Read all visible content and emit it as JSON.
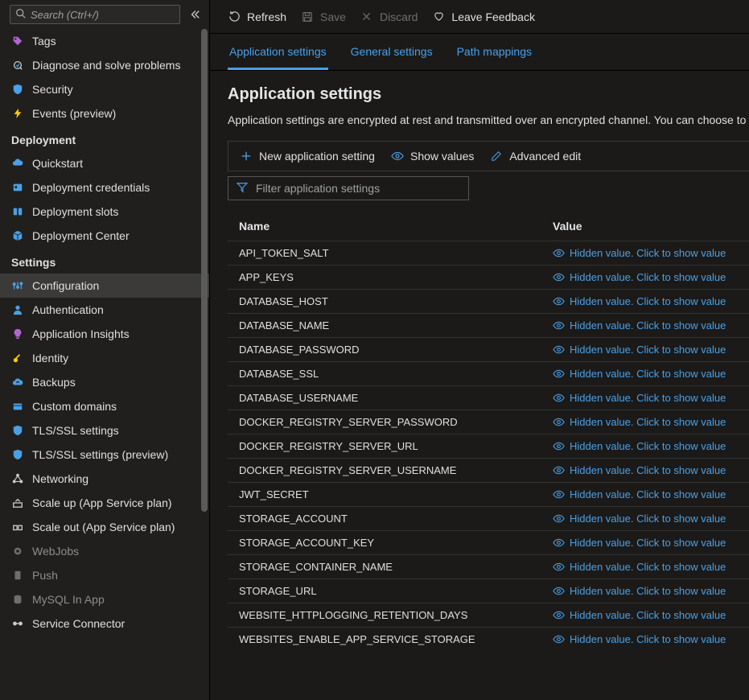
{
  "search": {
    "placeholder": "Search (Ctrl+/)"
  },
  "sidebar": {
    "preItems": [
      {
        "label": "Tags",
        "icon": "tag",
        "color": "#b265d1"
      },
      {
        "label": "Diagnose and solve problems",
        "icon": "diagnose",
        "color": "#ccc"
      },
      {
        "label": "Security",
        "icon": "shield",
        "color": "#4aa0e6"
      },
      {
        "label": "Events (preview)",
        "icon": "bolt",
        "color": "#ffcc00"
      }
    ],
    "sections": [
      {
        "title": "Deployment",
        "items": [
          {
            "label": "Quickstart",
            "icon": "cloud",
            "color": "#4aa0e6"
          },
          {
            "label": "Deployment credentials",
            "icon": "badge",
            "color": "#4aa0e6"
          },
          {
            "label": "Deployment slots",
            "icon": "slots",
            "color": "#4aa0e6"
          },
          {
            "label": "Deployment Center",
            "icon": "cube",
            "color": "#4aa0e6"
          }
        ]
      },
      {
        "title": "Settings",
        "items": [
          {
            "label": "Configuration",
            "icon": "sliders",
            "color": "#4aa0e6",
            "selected": true
          },
          {
            "label": "Authentication",
            "icon": "person",
            "color": "#4aa0e6"
          },
          {
            "label": "Application Insights",
            "icon": "bulb",
            "color": "#b265d1"
          },
          {
            "label": "Identity",
            "icon": "key",
            "color": "#ffcc00"
          },
          {
            "label": "Backups",
            "icon": "cloud-up",
            "color": "#4aa0e6"
          },
          {
            "label": "Custom domains",
            "icon": "domains",
            "color": "#4aa0e6"
          },
          {
            "label": "TLS/SSL settings",
            "icon": "shield",
            "color": "#4aa0e6"
          },
          {
            "label": "TLS/SSL settings (preview)",
            "icon": "shield",
            "color": "#4aa0e6"
          },
          {
            "label": "Networking",
            "icon": "network",
            "color": "#ccc"
          },
          {
            "label": "Scale up (App Service plan)",
            "icon": "scale-up",
            "color": "#ccc"
          },
          {
            "label": "Scale out (App Service plan)",
            "icon": "scale-out",
            "color": "#ccc"
          },
          {
            "label": "WebJobs",
            "icon": "gear",
            "color": "#6e6e6e",
            "disabled": true
          },
          {
            "label": "Push",
            "icon": "push",
            "color": "#6e6e6e",
            "disabled": true
          },
          {
            "label": "MySQL In App",
            "icon": "database",
            "color": "#6e6e6e",
            "disabled": true
          },
          {
            "label": "Service Connector",
            "icon": "connector",
            "color": "#ccc"
          }
        ]
      }
    ]
  },
  "toolbar": {
    "refresh": "Refresh",
    "save": "Save",
    "discard": "Discard",
    "feedback": "Leave Feedback"
  },
  "tabs": [
    {
      "label": "Application settings",
      "active": true
    },
    {
      "label": "General settings"
    },
    {
      "label": "Path mappings"
    }
  ],
  "page": {
    "title": "Application settings",
    "desc": "Application settings are encrypted at rest and transmitted over an encrypted channel. You can choose to"
  },
  "actionBar": {
    "new": "New application setting",
    "show": "Show values",
    "edit": "Advanced edit"
  },
  "filter": {
    "placeholder": "Filter application settings"
  },
  "table": {
    "columns": {
      "name": "Name",
      "value": "Value"
    },
    "hiddenLabel": "Hidden value. Click to show value",
    "rows": [
      "API_TOKEN_SALT",
      "APP_KEYS",
      "DATABASE_HOST",
      "DATABASE_NAME",
      "DATABASE_PASSWORD",
      "DATABASE_SSL",
      "DATABASE_USERNAME",
      "DOCKER_REGISTRY_SERVER_PASSWORD",
      "DOCKER_REGISTRY_SERVER_URL",
      "DOCKER_REGISTRY_SERVER_USERNAME",
      "JWT_SECRET",
      "STORAGE_ACCOUNT",
      "STORAGE_ACCOUNT_KEY",
      "STORAGE_CONTAINER_NAME",
      "STORAGE_URL",
      "WEBSITE_HTTPLOGGING_RETENTION_DAYS",
      "WEBSITES_ENABLE_APP_SERVICE_STORAGE"
    ]
  }
}
